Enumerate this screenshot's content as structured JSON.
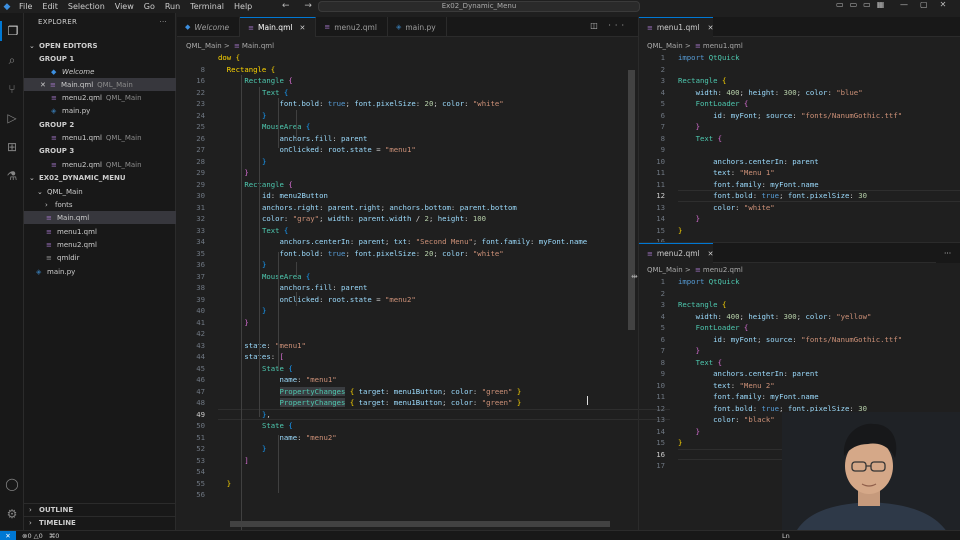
{
  "menu": [
    "File",
    "Edit",
    "Selection",
    "View",
    "Go",
    "Run",
    "Terminal",
    "Help"
  ],
  "search_text": "Ex02_Dynamic_Menu",
  "nav_arrows": "← →",
  "explorer": {
    "title": "EXPLORER",
    "more": "···",
    "open_editors": "OPEN EDITORS",
    "groups": [
      {
        "label": "GROUP 1",
        "files": [
          {
            "name": "Welcome",
            "desc": ""
          },
          {
            "name": "Main.qml",
            "desc": "QML_Main"
          },
          {
            "name": "menu2.qml",
            "desc": "QML_Main"
          },
          {
            "name": "main.py",
            "desc": ""
          }
        ]
      },
      {
        "label": "GROUP 2",
        "files": [
          {
            "name": "menu1.qml",
            "desc": "QML_Main"
          }
        ]
      },
      {
        "label": "GROUP 3",
        "files": [
          {
            "name": "menu2.qml",
            "desc": "QML_Main"
          }
        ]
      }
    ],
    "workspace": "EX02_DYNAMIC_MENU",
    "tree": {
      "folder": "QML_Main",
      "fonts": "fonts",
      "files": [
        "Main.qml",
        "menu1.qml",
        "menu2.qml",
        "qmldir"
      ],
      "root_file": "main.py"
    },
    "outline": "OUTLINE",
    "timeline": "TIMELINE"
  },
  "tabs1": [
    {
      "name": "Welcome"
    },
    {
      "name": "Main.qml",
      "close": "✕"
    },
    {
      "name": "menu2.qml"
    },
    {
      "name": "main.py"
    }
  ],
  "editor_actions": "◫ ···",
  "crumb1": {
    "folder": "QML_Main",
    "sep": ">",
    "file": "Main.qml"
  },
  "code1_top": "dow {",
  "code1": [
    {
      "n": "8",
      "h": "<span class='br1'>  Rectangle {</span>"
    },
    {
      "n": "16",
      "h": "      <span class='ty'>Rectangle</span> <span class='br2'>{</span>"
    },
    {
      "n": "22",
      "h": "          <span class='ty'>Text</span> <span class='br3'>{</span>"
    },
    {
      "n": "23",
      "h": "              <span class='p'>font.bold</span><span class='pl'>: </span><span class='k'>true</span><span class='pl'>; </span><span class='p'>font.pixelSize</span><span class='pl'>: </span><span class='n'>20</span><span class='pl'>; </span><span class='p'>color</span><span class='pl'>: </span><span class='s'>\"white\"</span>"
    },
    {
      "n": "24",
      "h": "          <span class='br3'>}</span>"
    },
    {
      "n": "25",
      "h": "          <span class='ty'>MouseArea</span> <span class='br3'>{</span>"
    },
    {
      "n": "26",
      "h": "              <span class='p'>anchors.fill</span><span class='pl'>: </span><span class='p'>parent</span>"
    },
    {
      "n": "27",
      "h": "              <span class='p'>onClicked</span><span class='pl'>: </span><span class='p'>root.state</span><span class='pl'> = </span><span class='s'>\"menu1\"</span>"
    },
    {
      "n": "28",
      "h": "          <span class='br3'>}</span>"
    },
    {
      "n": "29",
      "h": "      <span class='br2'>}</span>"
    },
    {
      "n": "29",
      "h": "      <span class='ty'>Rectangle</span> <span class='br2'>{</span>"
    },
    {
      "n": "30",
      "h": "          <span class='p'>id</span><span class='pl'>: </span><span class='p'>menu2Button</span>"
    },
    {
      "n": "31",
      "h": "          <span class='p'>anchors.right</span><span class='pl'>: </span><span class='p'>parent.right</span><span class='pl'>; </span><span class='p'>anchors.bottom</span><span class='pl'>: </span><span class='p'>parent.bottom</span>"
    },
    {
      "n": "32",
      "h": "          <span class='p'>color</span><span class='pl'>: </span><span class='s'>\"gray\"</span><span class='pl'>; </span><span class='p'>width</span><span class='pl'>: </span><span class='p'>parent.width</span><span class='pl'> / </span><span class='n'>2</span><span class='pl'>; </span><span class='p'>height</span><span class='pl'>: </span><span class='n'>100</span>"
    },
    {
      "n": "33",
      "h": "          <span class='ty'>Text</span> <span class='br3'>{</span>"
    },
    {
      "n": "34",
      "h": "              <span class='p'>anchors.centerIn</span><span class='pl'>: </span><span class='p'>parent</span><span class='pl'>; </span><span class='p'>txt</span><span class='pl'>: </span><span class='s'>\"Second Menu\"</span><span class='pl'>; </span><span class='p'>font.family</span><span class='pl'>: </span><span class='p'>myFont.name</span>"
    },
    {
      "n": "35",
      "h": "              <span class='p'>font.bold</span><span class='pl'>: </span><span class='k'>true</span><span class='pl'>; </span><span class='p'>font.pixelSize</span><span class='pl'>: </span><span class='n'>20</span><span class='pl'>; </span><span class='p'>color</span><span class='pl'>: </span><span class='s'>\"white\"</span>"
    },
    {
      "n": "36",
      "h": "          <span class='br3'>}</span>"
    },
    {
      "n": "37",
      "h": "          <span class='ty'>MouseArea</span> <span class='br3'>{</span>"
    },
    {
      "n": "38",
      "h": "              <span class='p'>anchors.fill</span><span class='pl'>: </span><span class='p'>parent</span>"
    },
    {
      "n": "39",
      "h": "              <span class='p'>onClicked</span><span class='pl'>: </span><span class='p'>root.state</span><span class='pl'> = </span><span class='s'>\"menu2\"</span>"
    },
    {
      "n": "40",
      "h": "          <span class='br3'>}</span>"
    },
    {
      "n": "41",
      "h": "      <span class='br2'>}</span>"
    },
    {
      "n": "42",
      "h": ""
    },
    {
      "n": "43",
      "h": "      <span class='p'>state</span><span class='pl'>: </span><span class='s'>\"menu1\"</span>"
    },
    {
      "n": "44",
      "h": "      <span class='p'>states</span><span class='pl'>: </span><span class='br2'>[</span>"
    },
    {
      "n": "45",
      "h": "          <span class='ty'>State</span> <span class='br3'>{</span>"
    },
    {
      "n": "46",
      "h": "              <span class='p'>name</span><span class='pl'>: </span><span class='s'>\"menu1\"</span>"
    },
    {
      "n": "47",
      "h": "              <span class='hl'>PropertyChanges</span> <span class='br1'>{</span> <span class='p'>target</span><span class='pl'>: </span><span class='p'>menu1Button</span><span class='pl'>; </span><span class='p'>color</span><span class='pl'>: </span><span class='s'>\"green\"</span> <span class='br1'>}</span>"
    },
    {
      "n": "48",
      "h": "              <span class='hl'>PropertyChanges</span> <span class='br1'>{</span> <span class='p'>target</span><span class='pl'>: </span><span class='p'>menu1Button</span><span class='pl'>; </span><span class='p'>color</span><span class='pl'>: </span><span class='s'>\"green\"</span> <span class='br1'>}</span>"
    },
    {
      "n": "49",
      "h": "          <span class='br3'>}</span><span class='pl'>,</span>"
    },
    {
      "n": "50",
      "h": "          <span class='ty'>State</span> <span class='br3'>{</span>"
    },
    {
      "n": "51",
      "h": "              <span class='p'>name</span><span class='pl'>: </span><span class='s'>\"menu2\"</span>"
    },
    {
      "n": "52",
      "h": "          <span class='br3'>}</span>"
    },
    {
      "n": "53",
      "h": "      <span class='br2'>]</span>"
    },
    {
      "n": "54",
      "h": ""
    },
    {
      "n": "55",
      "h": "  <span class='br1'>}</span>"
    },
    {
      "n": "56",
      "h": ""
    }
  ],
  "menu1": {
    "tab": "menu1.qml",
    "crumb_folder": "QML_Main",
    "crumb_file": "menu1.qml",
    "lines": [
      {
        "n": "1",
        "h": "<span class='k'>import</span> <span class='ty'>QtQuick</span>"
      },
      {
        "n": "2",
        "h": ""
      },
      {
        "n": "3",
        "h": "<span class='ty'>Rectangle</span> <span class='br1'>{</span>"
      },
      {
        "n": "4",
        "h": "    <span class='p'>width</span><span class='pl'>: </span><span class='n'>400</span><span class='pl'>; </span><span class='p'>height</span><span class='pl'>: </span><span class='n'>300</span><span class='pl'>; </span><span class='p'>color</span><span class='pl'>: </span><span class='s'>\"blue\"</span>"
      },
      {
        "n": "5",
        "h": "    <span class='ty'>FontLoader</span> <span class='br2'>{</span>"
      },
      {
        "n": "6",
        "h": "        <span class='p'>id</span><span class='pl'>: </span><span class='p'>myFont</span><span class='pl'>; </span><span class='p'>source</span><span class='pl'>: </span><span class='s'>\"fonts/NanumGothic.ttf\"</span>"
      },
      {
        "n": "7",
        "h": "    <span class='br2'>}</span>"
      },
      {
        "n": "8",
        "h": "    <span class='ty'>Text</span> <span class='br2'>{</span>"
      },
      {
        "n": "9",
        "h": ""
      },
      {
        "n": "10",
        "h": "        <span class='p'>anchors.centerIn</span><span class='pl'>: </span><span class='p'>parent</span>"
      },
      {
        "n": "11",
        "h": "        <span class='p'>text</span><span class='pl'>: </span><span class='s'>\"Menu 1\"</span>"
      },
      {
        "n": "11",
        "h": "        <span class='p'>font.family</span><span class='pl'>: </span><span class='p'>myFont.name</span>"
      },
      {
        "n": "12",
        "h": "        <span class='p'>font.bold</span><span class='pl'>: </span><span class='k'>true</span><span class='pl'>; </span><span class='p'>font.pixelSize</span><span class='pl'>: </span><span class='n'>30</span>"
      },
      {
        "n": "13",
        "h": "        <span class='p'>color</span><span class='pl'>: </span><span class='s'>\"white\"</span>"
      },
      {
        "n": "14",
        "h": "    <span class='br2'>}</span>"
      },
      {
        "n": "15",
        "h": "<span class='br1'>}</span>"
      },
      {
        "n": "16",
        "h": ""
      },
      {
        "n": "17",
        "h": ""
      }
    ]
  },
  "menu2": {
    "tab": "menu2.qml",
    "crumb_folder": "QML_Main",
    "crumb_file": "menu2.qml",
    "lines": [
      {
        "n": "1",
        "h": "<span class='k'>import</span> <span class='ty'>QtQuick</span>"
      },
      {
        "n": "2",
        "h": ""
      },
      {
        "n": "3",
        "h": "<span class='ty'>Rectangle</span> <span class='br1'>{</span>"
      },
      {
        "n": "4",
        "h": "    <span class='p'>width</span><span class='pl'>: </span><span class='n'>400</span><span class='pl'>; </span><span class='p'>height</span><span class='pl'>: </span><span class='n'>300</span><span class='pl'>; </span><span class='p'>color</span><span class='pl'>: </span><span class='s'>\"yellow\"</span>"
      },
      {
        "n": "5",
        "h": "    <span class='ty'>FontLoader</span> <span class='br2'>{</span>"
      },
      {
        "n": "6",
        "h": "        <span class='p'>id</span><span class='pl'>: </span><span class='p'>myFont</span><span class='pl'>; </span><span class='p'>source</span><span class='pl'>: </span><span class='s'>\"fonts/NanumGothic.ttf\"</span>"
      },
      {
        "n": "7",
        "h": "    <span class='br2'>}</span>"
      },
      {
        "n": "8",
        "h": "    <span class='ty'>Text</span> <span class='br2'>{</span>"
      },
      {
        "n": "9",
        "h": "        <span class='p'>anchors.centerIn</span><span class='pl'>: </span><span class='p'>parent</span>"
      },
      {
        "n": "10",
        "h": "        <span class='p'>text</span><span class='pl'>: </span><span class='s'>\"Menu 2\"</span>"
      },
      {
        "n": "11",
        "h": "        <span class='p'>font.family</span><span class='pl'>: </span><span class='p'>myFont.name</span>"
      },
      {
        "n": "12",
        "h": "        <span class='p'>font.bold</span><span class='pl'>: </span><span class='k'>true</span><span class='pl'>; </span><span class='p'>font.pixelSize</span><span class='pl'>: </span><span class='n'>30</span>"
      },
      {
        "n": "13",
        "h": "        <span class='p'>color</span><span class='pl'>: </span><span class='s'>\"black\"</span>"
      },
      {
        "n": "14",
        "h": "    <span class='br2'>}</span>"
      },
      {
        "n": "15",
        "h": "<span class='br1'>}</span>"
      },
      {
        "n": "16",
        "h": ""
      },
      {
        "n": "17",
        "h": ""
      }
    ]
  },
  "status": {
    "remote": "✕",
    "problems": "⊗0 △0",
    "ports": "⌘0",
    "position": "Ln"
  },
  "colors": {
    "accent": "#0078d4",
    "bg": "#1f1f1f",
    "sidebar": "#181818"
  }
}
